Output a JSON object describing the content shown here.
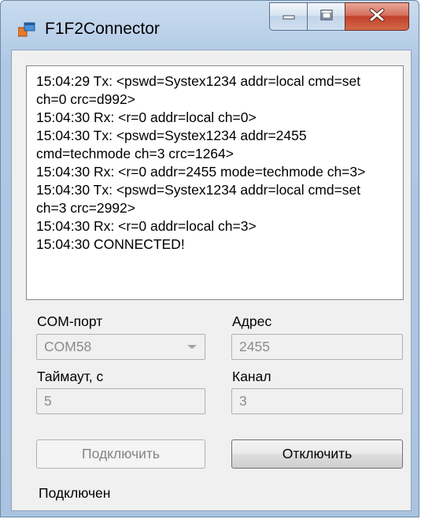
{
  "window": {
    "title": "F1F2Connector"
  },
  "log": {
    "lines": [
      "15:04:29 Tx: <pswd=Systex1234 addr=local cmd=set",
      "ch=0 crc=d992>",
      "15:04:30 Rx: <r=0 addr=local ch=0>",
      "15:04:30 Tx: <pswd=Systex1234 addr=2455",
      "cmd=techmode ch=3 crc=1264>",
      "15:04:30 Rx: <r=0 addr=2455 mode=techmode ch=3>",
      "15:04:30 Tx: <pswd=Systex1234 addr=local cmd=set",
      "ch=3 crc=2992>",
      "15:04:30 Rx: <r=0 addr=local ch=3>",
      "15:04:30 CONNECTED!"
    ]
  },
  "form": {
    "com_port_label": "COM-порт",
    "com_port_value": "COM58",
    "address_label": "Адрес",
    "address_value": "2455",
    "timeout_label": "Таймаут, с",
    "timeout_value": "5",
    "channel_label": "Канал",
    "channel_value": "3"
  },
  "buttons": {
    "connect_label": "Подключить",
    "disconnect_label": "Отключить"
  },
  "status": {
    "text": "Подключен"
  },
  "icons": {
    "app": "application-window-icon",
    "minimize": "minimize-icon",
    "maximize": "maximize-icon",
    "close": "close-icon",
    "combo": "chevron-down-icon"
  },
  "colors": {
    "frame": "#bcd2ea",
    "close_button": "#c2412a",
    "client_background": "#f0f0f0"
  }
}
